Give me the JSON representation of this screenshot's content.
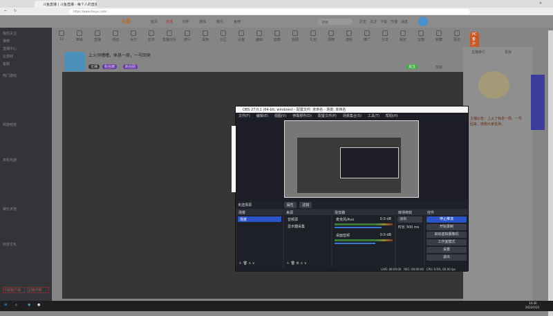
{
  "browser": {
    "tab_title": "斗鱼直播 | 斗鱼直播 - 每个人的直播平台",
    "url": "https://www.douyu.com/..."
  },
  "site": {
    "nav": [
      "首页",
      "直播",
      "分类",
      "游戏",
      "娱乐",
      "鱼吧"
    ],
    "search_placeholder": "搜索",
    "top_icons": [
      "历史",
      "关注",
      "下载",
      "开播",
      "消息"
    ],
    "icons": [
      "12",
      "等级",
      "直播",
      "活动",
      "大厅",
      "任务",
      "直播日历",
      "排行",
      "贵族",
      "分区",
      "设置",
      "编辑",
      "勋章",
      "视频",
      "礼包",
      "周榜",
      "游戏",
      "推广",
      "分享",
      "锁定",
      "宝箱",
      "收藏",
      "更多"
    ],
    "download_btn": "PC客户端"
  },
  "sidebar": {
    "items": [
      "我的关注",
      "推荐",
      "直播中心",
      "云游戏",
      "客服"
    ],
    "sections": [
      "热门游戏",
      "网游竞技",
      "单机热游",
      "娱乐天地",
      "科技文化"
    ],
    "footer": [
      "下载客户端",
      "主播开播"
    ]
  },
  "streamer": {
    "title": "上火须嘈嘈，休息一周，一号回来",
    "tag1": "主播",
    "tag2": "粉丝牌",
    "tag3": "粉丝团",
    "follow": "关注",
    "report": "举报"
  },
  "right_panel": {
    "tabs": [
      "主播排行",
      "贵族"
    ],
    "notice": "主播公告：上火了休息一周，一号回来，感谢大家支持。"
  },
  "obs": {
    "title": "OBS 27.0.1 (64-bit, windows) - 配置文件: 未命名 - 场景: 未命名",
    "menu": [
      "文件(F)",
      "编辑(E)",
      "视图(V)",
      "停靠部件(D)",
      "配置文件(P)",
      "场景集合(S)",
      "工具(T)",
      "帮助(H)"
    ],
    "no_source": "未选择源",
    "props_btn": "属性",
    "filters_btn": "滤镜",
    "docks": {
      "scenes": "场景",
      "sources": "来源",
      "mixer": "混音器",
      "transitions": "转场特效",
      "controls": "控件"
    },
    "scene_items": [
      "场景"
    ],
    "source_items": [
      "音频源",
      "显示器采集"
    ],
    "mixer": [
      {
        "name": "麦克风/Aux",
        "db": "0.0 dB"
      },
      {
        "name": "桌面音频",
        "db": "0.0 dB"
      }
    ],
    "transition": "淡出",
    "duration_label": "时长",
    "duration": "300 ms",
    "controls": [
      "停止推流",
      "开始录制",
      "启动虚拟摄像机",
      "工作室模式",
      "设置",
      "退出"
    ],
    "status": {
      "live": "LIVE: 00:00:00",
      "rec": "REC: 00:00:00",
      "cpu": "CPU: 0.6%, 60.00 fps"
    }
  },
  "taskbar": {
    "time": "14:30",
    "date": "2022/10/1"
  }
}
